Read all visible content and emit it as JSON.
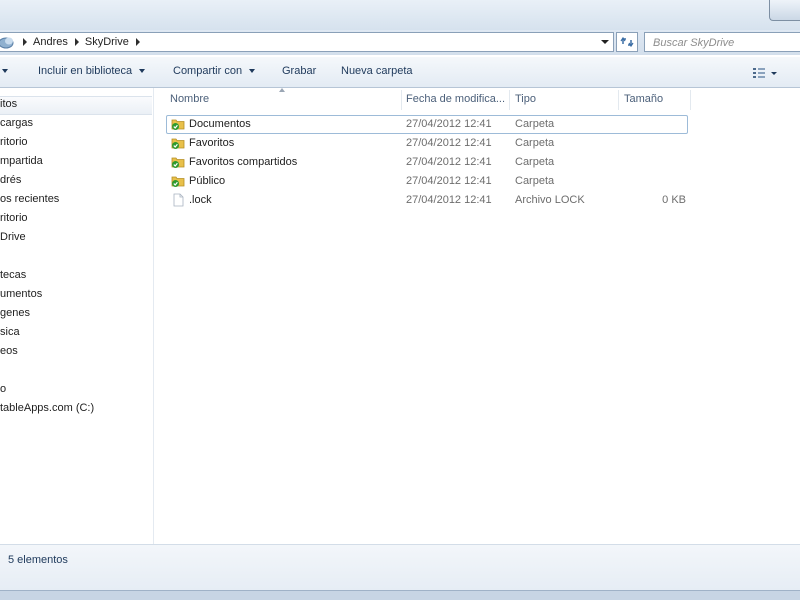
{
  "address": {
    "breadcrumbs": [
      "Andres",
      "SkyDrive"
    ],
    "search_placeholder": "Buscar SkyDrive"
  },
  "toolbar": {
    "include_label": "Incluir en biblioteca",
    "share_label": "Compartir con",
    "burn_label": "Grabar",
    "new_folder_label": "Nueva carpeta"
  },
  "nav": {
    "items": [
      "itos",
      "cargas",
      "ritorio",
      "mpartida",
      "drés",
      "os recientes",
      "ritorio",
      "Drive",
      "tecas",
      "umentos",
      "genes",
      "sica",
      "eos",
      "o",
      "tableApps.com (C:)"
    ],
    "selected_index": 0
  },
  "columns": {
    "name": "Nombre",
    "date": "Fecha de modifica...",
    "type": "Tipo",
    "size": "Tamaño"
  },
  "files": [
    {
      "name": "Documentos",
      "date": "27/04/2012 12:41",
      "type": "Carpeta",
      "size": "",
      "icon": "synced-folder-icon"
    },
    {
      "name": "Favoritos",
      "date": "27/04/2012 12:41",
      "type": "Carpeta",
      "size": "",
      "icon": "synced-folder-icon"
    },
    {
      "name": "Favoritos compartidos",
      "date": "27/04/2012 12:41",
      "type": "Carpeta",
      "size": "",
      "icon": "synced-folder-icon"
    },
    {
      "name": "Público",
      "date": "27/04/2012 12:41",
      "type": "Carpeta",
      "size": "",
      "icon": "synced-folder-icon"
    },
    {
      "name": ".lock",
      "date": "27/04/2012 12:41",
      "type": "Archivo LOCK",
      "size": "0 KB",
      "icon": "blank-file-icon"
    }
  ],
  "status": {
    "count_text": "5 elementos"
  },
  "colors": {
    "window_chrome": "#dfe8f3",
    "selection_border": "#9dbbd8",
    "sync_check": "#2e9a2e",
    "folder": "#e8c04a"
  }
}
